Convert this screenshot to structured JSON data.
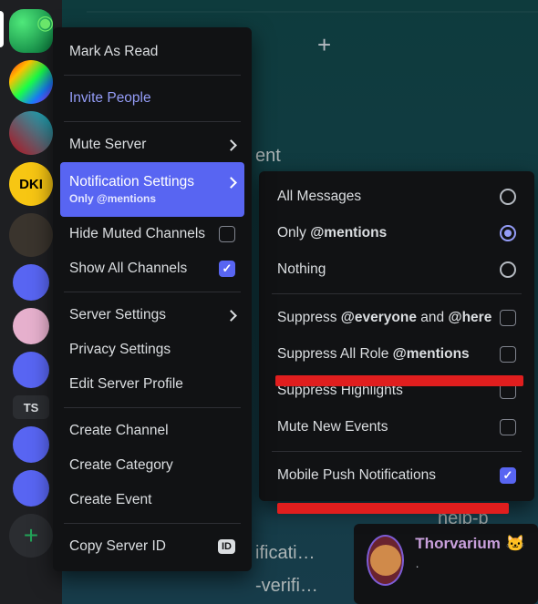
{
  "server_rail": {
    "items": [
      {
        "label": "",
        "class": "bg0"
      },
      {
        "label": "",
        "class": "bg1"
      },
      {
        "label": "",
        "class": "bg2"
      },
      {
        "label": "DKI",
        "class": "bg3"
      },
      {
        "label": "",
        "class": "bg4"
      },
      {
        "label": "",
        "class": "bg5"
      },
      {
        "label": "",
        "class": "bg6"
      },
      {
        "label": "",
        "class": "bg7"
      },
      {
        "label": "TS",
        "class": "bg8"
      },
      {
        "label": "",
        "class": "bg9"
      },
      {
        "label": "",
        "class": "bg10"
      }
    ],
    "add_label": "+"
  },
  "context_menu": {
    "mark_read": "Mark As Read",
    "invite": "Invite People",
    "mute": "Mute Server",
    "notifications_label": "Notification Settings",
    "notifications_sub": "Only @mentions",
    "hide_muted": "Hide Muted Channels",
    "show_all": "Show All Channels",
    "server_settings": "Server Settings",
    "privacy": "Privacy Settings",
    "edit_profile": "Edit Server Profile",
    "create_channel": "Create Channel",
    "create_category": "Create Category",
    "create_event": "Create Event",
    "copy_id": "Copy Server ID",
    "id_badge": "ID"
  },
  "submenu": {
    "all": "All Messages",
    "only_pre": "Only ",
    "only_bold": "@mentions",
    "nothing": "Nothing",
    "suppress_everyone_pre": "Suppress ",
    "suppress_everyone_b1": "@everyone",
    "suppress_everyone_mid": " and ",
    "suppress_everyone_b2": "@here",
    "suppress_role_pre": "Suppress All Role ",
    "suppress_role_bold": "@mentions",
    "suppress_highlights": "Suppress Highlights",
    "mute_events": "Mute New Events",
    "mobile_push": "Mobile Push Notifications"
  },
  "bg": {
    "ent": "ent",
    "plus": "+",
    "ificati": "ificati…",
    "ificati2": "ificati…",
    "verifi": "-verifi…",
    "help": "help-b"
  },
  "friend": {
    "name": "Thorvarium",
    "dot": "·",
    "emoji": "🐱"
  },
  "colors": {
    "accent": "#5865f2",
    "danger_marker": "#e01e1e"
  }
}
